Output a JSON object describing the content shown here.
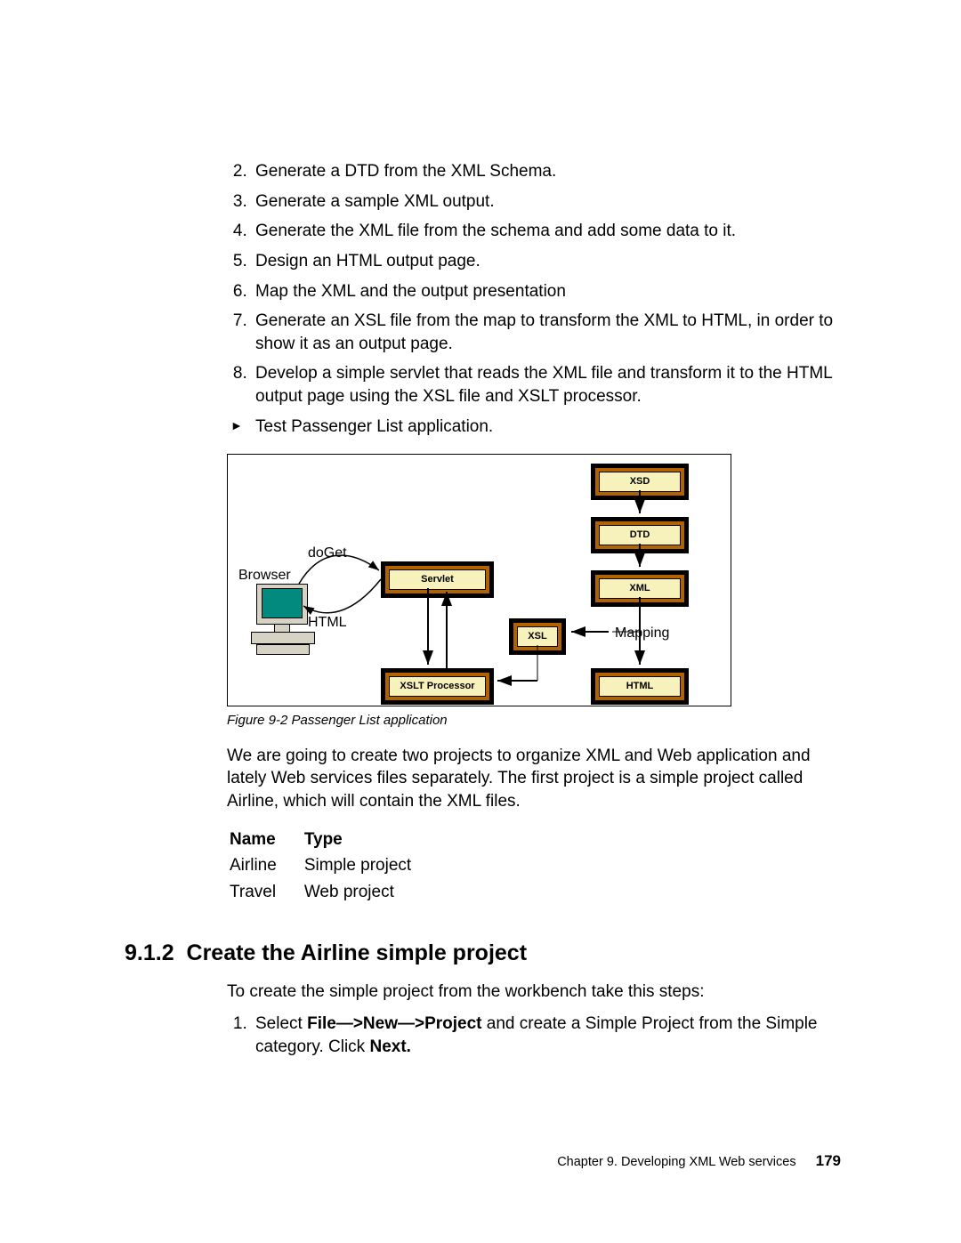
{
  "list": {
    "i2": "Generate a DTD from the XML Schema.",
    "i3": "Generate a sample XML output.",
    "i4": "Generate the XML file from the schema and add some data to it.",
    "i5": "Design an HTML output page.",
    "i6": "Map the XML and the output presentation",
    "i7": "Generate an XSL file from the map to transform the XML to HTML, in order to show it as an output page.",
    "i8": "Develop a simple servlet that reads the XML file and transform it to the HTML output page using the XSL file and XSLT processor.",
    "tri": "Test Passenger List application."
  },
  "diagram": {
    "browser": "Browser",
    "doGet": "doGet",
    "html_label": "HTML",
    "mapping": "Mapping",
    "nodes": {
      "servlet": "Servlet",
      "xsl": "XSL",
      "xslt": "XSLT Processor",
      "xsd": "XSD",
      "dtd": "DTD",
      "xml": "XML",
      "html": "HTML"
    }
  },
  "figure_caption": "Figure 9-2   Passenger List application",
  "para1": "We are going to create two projects to organize XML and Web application and lately Web services files separately. The first project is a simple project called Airline, which will contain the XML files.",
  "table": {
    "h1": "Name",
    "h2": "Type",
    "r1c1": "Airline",
    "r1c2": "Simple project",
    "r2c1": "Travel",
    "r2c2": "Web project"
  },
  "section": {
    "num": "9.1.2",
    "title": "Create the Airline simple project"
  },
  "para2": "To create the simple project from the workbench take this steps:",
  "step1": {
    "pre": "Select ",
    "bold1": "File—>New—>Project",
    "mid": " and create a Simple Project from the Simple category. Click ",
    "bold2": "Next."
  },
  "footer": {
    "chapter": "Chapter 9. Developing XML Web services",
    "page": "179"
  }
}
